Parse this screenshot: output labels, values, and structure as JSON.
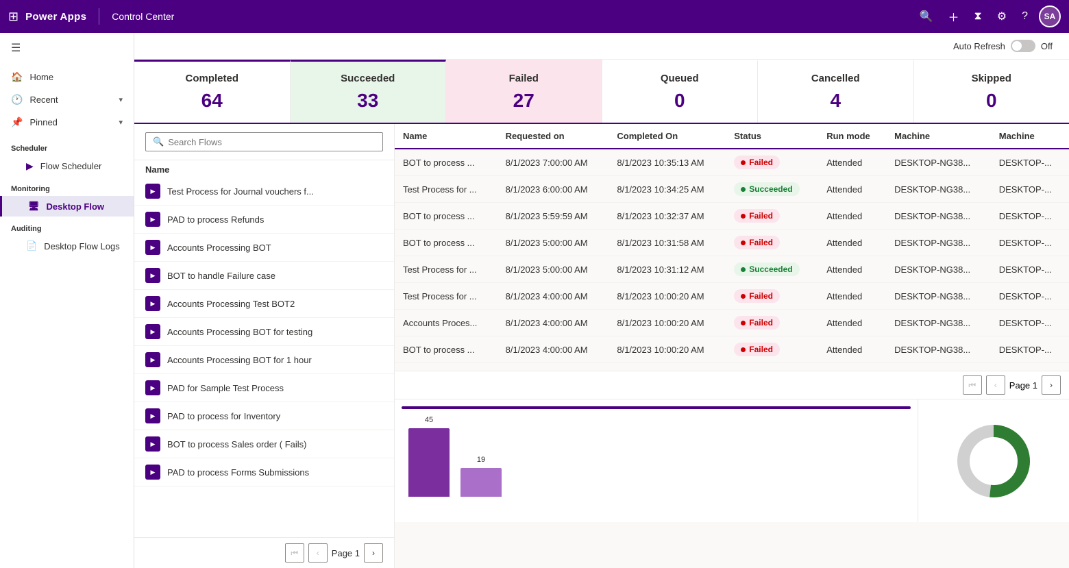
{
  "topbar": {
    "app_name": "Power Apps",
    "section": "Control Center",
    "avatar_label": "SA"
  },
  "auto_refresh": {
    "label": "Auto Refresh",
    "state": "Off"
  },
  "stats": [
    {
      "id": "completed",
      "label": "Completed",
      "value": "64",
      "style": "completed"
    },
    {
      "id": "succeeded",
      "label": "Succeeded",
      "value": "33",
      "style": "succeeded"
    },
    {
      "id": "failed",
      "label": "Failed",
      "value": "27",
      "style": "failed"
    },
    {
      "id": "queued",
      "label": "Queued",
      "value": "0",
      "style": ""
    },
    {
      "id": "cancelled",
      "label": "Cancelled",
      "value": "4",
      "style": ""
    },
    {
      "id": "skipped",
      "label": "Skipped",
      "value": "0",
      "style": ""
    }
  ],
  "sidebar": {
    "hamburger_label": "☰",
    "items": [
      {
        "id": "home",
        "label": "Home",
        "icon": "🏠",
        "type": "item"
      },
      {
        "id": "recent",
        "label": "Recent",
        "icon": "🕐",
        "type": "item",
        "chevron": true
      },
      {
        "id": "pinned",
        "label": "Pinned",
        "icon": "📌",
        "type": "item",
        "chevron": true
      }
    ],
    "groups": [
      {
        "label": "Scheduler",
        "items": [
          {
            "id": "flow-scheduler",
            "label": "Flow Scheduler",
            "icon": "▶",
            "active": false
          }
        ]
      },
      {
        "label": "Monitoring",
        "items": [
          {
            "id": "desktop-flow",
            "label": "Desktop Flow",
            "icon": "🖥",
            "active": true
          }
        ]
      },
      {
        "label": "Auditing",
        "items": [
          {
            "id": "desktop-flow-logs",
            "label": "Desktop Flow Logs",
            "icon": "📄",
            "active": false
          }
        ]
      }
    ]
  },
  "flow_list": {
    "search_placeholder": "Search Flows",
    "items": [
      {
        "name": "Test Process for Journal vouchers f..."
      },
      {
        "name": "PAD to process Refunds"
      },
      {
        "name": "Accounts Processing BOT"
      },
      {
        "name": "BOT to handle Failure case"
      },
      {
        "name": "Accounts Processing Test BOT2"
      },
      {
        "name": "Accounts Processing BOT for testing"
      },
      {
        "name": "Accounts Processing BOT for 1 hour"
      },
      {
        "name": "PAD for Sample Test Process"
      },
      {
        "name": "PAD to process for Inventory"
      },
      {
        "name": "BOT to process Sales order ( Fails)"
      },
      {
        "name": "PAD to process Forms Submissions"
      }
    ],
    "page_label": "Page 1"
  },
  "table": {
    "columns": [
      "Name",
      "Requested on",
      "Completed On",
      "Status",
      "Run mode",
      "Machine",
      "Machine"
    ],
    "rows": [
      {
        "name": "BOT to process ...",
        "requested": "8/1/2023 7:00:00 AM",
        "completed": "8/1/2023 10:35:13 AM",
        "status": "Failed",
        "run_mode": "Attended",
        "machine": "DESKTOP-NG38...",
        "machine2": "DESKTOP-..."
      },
      {
        "name": "Test Process for ...",
        "requested": "8/1/2023 6:00:00 AM",
        "completed": "8/1/2023 10:34:25 AM",
        "status": "Succeeded",
        "run_mode": "Attended",
        "machine": "DESKTOP-NG38...",
        "machine2": "DESKTOP-..."
      },
      {
        "name": "BOT to process ...",
        "requested": "8/1/2023 5:59:59 AM",
        "completed": "8/1/2023 10:32:37 AM",
        "status": "Failed",
        "run_mode": "Attended",
        "machine": "DESKTOP-NG38...",
        "machine2": "DESKTOP-..."
      },
      {
        "name": "BOT to process ...",
        "requested": "8/1/2023 5:00:00 AM",
        "completed": "8/1/2023 10:31:58 AM",
        "status": "Failed",
        "run_mode": "Attended",
        "machine": "DESKTOP-NG38...",
        "machine2": "DESKTOP-..."
      },
      {
        "name": "Test Process for ...",
        "requested": "8/1/2023 5:00:00 AM",
        "completed": "8/1/2023 10:31:12 AM",
        "status": "Succeeded",
        "run_mode": "Attended",
        "machine": "DESKTOP-NG38...",
        "machine2": "DESKTOP-..."
      },
      {
        "name": "Test Process for ...",
        "requested": "8/1/2023 4:00:00 AM",
        "completed": "8/1/2023 10:00:20 AM",
        "status": "Failed",
        "run_mode": "Attended",
        "machine": "DESKTOP-NG38...",
        "machine2": "DESKTOP-..."
      },
      {
        "name": "Accounts Proces...",
        "requested": "8/1/2023 4:00:00 AM",
        "completed": "8/1/2023 10:00:20 AM",
        "status": "Failed",
        "run_mode": "Attended",
        "machine": "DESKTOP-NG38...",
        "machine2": "DESKTOP-..."
      },
      {
        "name": "BOT to process ...",
        "requested": "8/1/2023 4:00:00 AM",
        "completed": "8/1/2023 10:00:20 AM",
        "status": "Failed",
        "run_mode": "Attended",
        "machine": "DESKTOP-NG38...",
        "machine2": "DESKTOP-..."
      }
    ],
    "page_label": "Page 1"
  },
  "charts": {
    "bar": {
      "bars": [
        {
          "label": "45",
          "height": 100,
          "color": "#7b2f9e"
        },
        {
          "label": "19",
          "height": 42,
          "color": "#a96fc9"
        }
      ]
    },
    "donut": {
      "succeeded_pct": 52,
      "failed_pct": 42,
      "other_pct": 6
    }
  }
}
